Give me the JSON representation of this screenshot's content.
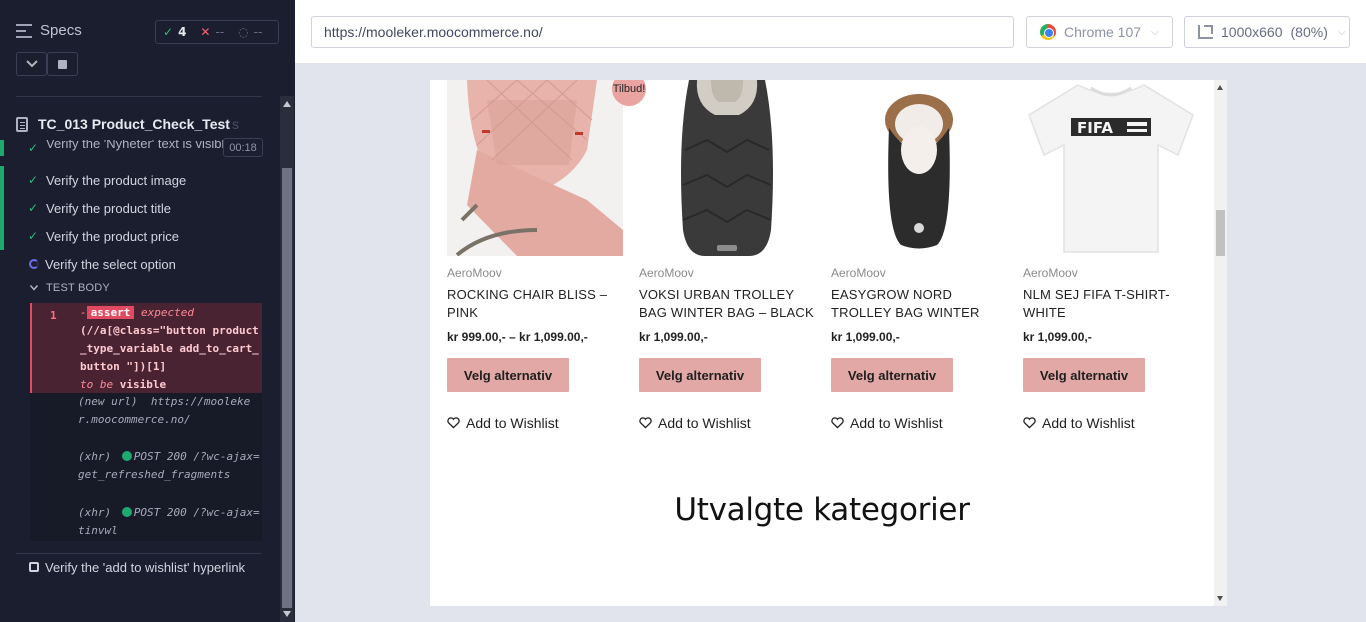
{
  "runner": {
    "specs_label": "Specs",
    "stats": {
      "passed": "4",
      "failed": "--",
      "pending": "--"
    },
    "spec_name": "TC_013 Product_Check_Test",
    "spec_suffix": "s",
    "timer": "00:18",
    "tests": [
      {
        "label": "Verify the 'Nyheter' text is visible",
        "state": "passed"
      },
      {
        "label": "Verify the product image",
        "state": "passed"
      },
      {
        "label": "Verify the product title",
        "state": "passed"
      },
      {
        "label": "Verify the product price",
        "state": "passed"
      },
      {
        "label": "Verify the select option",
        "state": "running"
      },
      {
        "label": "Verify the 'add to wishlist' hyperlink",
        "state": "pending"
      }
    ],
    "test_body_label": "TEST BODY",
    "command": {
      "number": "1",
      "dash": "-",
      "tag": "assert",
      "expected_word": "expected",
      "expression": "(//a[@class=\"button product_type_variable add_to_cart_button \"])[1]",
      "to_be": "to be",
      "visible": "visible"
    },
    "logs": [
      {
        "kind": "(new url)",
        "text": "https://mooleker.moocommerce.no/"
      },
      {
        "kind": "(xhr)",
        "text": "POST 200 /?wc-ajax=get_refreshed_fragments"
      },
      {
        "kind": "(xhr)",
        "text": "POST 200 /?wc-ajax=tinvwl"
      }
    ]
  },
  "toolbar": {
    "url": "https://mooleker.moocommerce.no/",
    "browser": "Chrome 107",
    "viewport": "1000x660",
    "zoom": "(80%)"
  },
  "site": {
    "products": [
      {
        "brand": "AeroMoov",
        "title": "ROCKING CHAIR BLISS – PINK",
        "price": "kr 999.00,- – kr 1,099.00,-",
        "button": "Velg alternativ",
        "wishlist": "Add to Wishlist",
        "sale_badge": "Tilbud!"
      },
      {
        "brand": "AeroMoov",
        "title": "VOKSI URBAN TROLLEY BAG WINTER BAG – BLACK",
        "price": "kr 1,099.00,-",
        "button": "Velg alternativ",
        "wishlist": "Add to Wishlist"
      },
      {
        "brand": "AeroMoov",
        "title": "EASYGROW NORD TROLLEY BAG WINTER",
        "price": "kr 1,099.00,-",
        "button": "Velg alternativ",
        "wishlist": "Add to Wishlist"
      },
      {
        "brand": "AeroMoov",
        "title": "NLM SEJ FIFA T-SHIRT-WHITE",
        "price": "kr 1,099.00,-",
        "button": "Velg alternativ",
        "wishlist": "Add to Wishlist",
        "shirt_print": "FIFA"
      }
    ],
    "section_heading": "Utvalgte kategorier"
  },
  "colors": {
    "runner_bg": "#1b1e2e",
    "pass_green": "#1fa971",
    "fail_red": "#e24a61",
    "button_pink": "#e1a8a6"
  }
}
